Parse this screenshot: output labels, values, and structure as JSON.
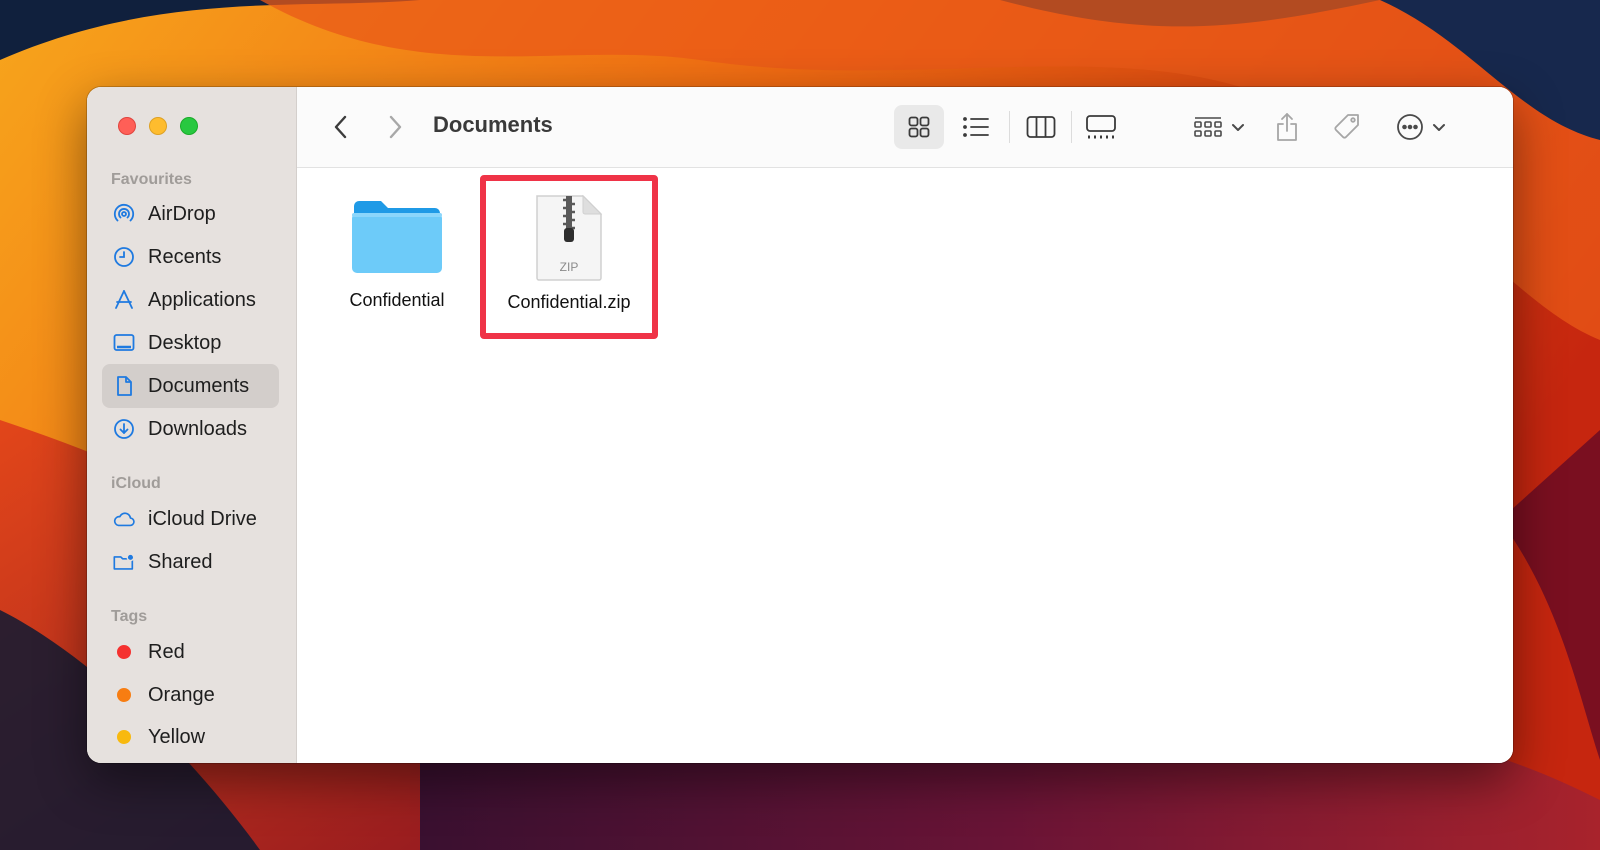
{
  "window": {
    "title": "Documents"
  },
  "sidebar": {
    "sections": {
      "favourites": "Favourites",
      "icloud": "iCloud",
      "tags": "Tags"
    },
    "favourites": [
      {
        "label": "AirDrop",
        "icon": "airdrop-icon"
      },
      {
        "label": "Recents",
        "icon": "clock-icon"
      },
      {
        "label": "Applications",
        "icon": "applications-icon"
      },
      {
        "label": "Desktop",
        "icon": "desktop-icon"
      },
      {
        "label": "Documents",
        "icon": "document-icon",
        "selected": true
      },
      {
        "label": "Downloads",
        "icon": "download-icon"
      }
    ],
    "icloud": [
      {
        "label": "iCloud Drive",
        "icon": "cloud-icon"
      },
      {
        "label": "Shared",
        "icon": "shared-folder-icon"
      }
    ],
    "tags": [
      {
        "label": "Red",
        "color": "#f5312f"
      },
      {
        "label": "Orange",
        "color": "#f77d12"
      },
      {
        "label": "Yellow",
        "color": "#f8b90e"
      }
    ]
  },
  "toolbar": {
    "views": [
      "icon-view",
      "list-view",
      "column-view",
      "gallery-view"
    ],
    "selected_view": "icon-view"
  },
  "files": [
    {
      "name": "Confidential",
      "type": "folder",
      "icon": "folder-icon"
    },
    {
      "name": "Confidential.zip",
      "type": "zip",
      "icon": "zip-file-icon",
      "badge": "ZIP",
      "highlighted": true
    }
  ],
  "colors": {
    "accent": "#1f7ae0",
    "highlight": "#ef3347"
  }
}
